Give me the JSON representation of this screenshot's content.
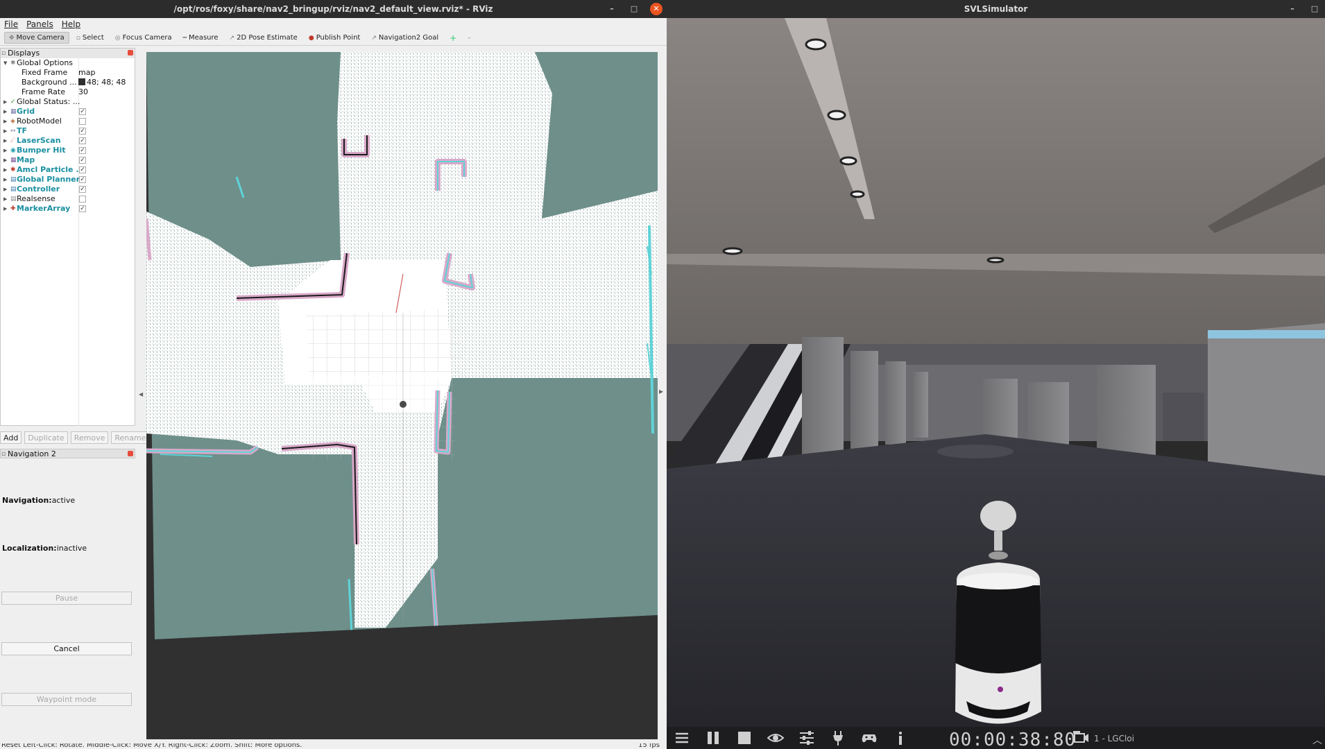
{
  "rviz": {
    "title": "/opt/ros/foxy/share/nav2_bringup/rviz/nav2_default_view.rviz* - RViz",
    "menu": [
      "File",
      "Panels",
      "Help"
    ],
    "tools": [
      {
        "label": "Move Camera",
        "icon": "move-camera-icon",
        "active": true
      },
      {
        "label": "Select",
        "icon": "select-icon"
      },
      {
        "label": "Focus Camera",
        "icon": "focus-camera-icon"
      },
      {
        "label": "Measure",
        "icon": "measure-icon"
      },
      {
        "label": "2D Pose Estimate",
        "icon": "pose-estimate-icon"
      },
      {
        "label": "Publish Point",
        "icon": "publish-point-icon"
      },
      {
        "label": "Navigation2 Goal",
        "icon": "nav-goal-icon"
      }
    ],
    "add_tool_glyph": "+",
    "more_tools_glyph": "–",
    "displays": {
      "header": "Displays",
      "global_options": "Global Options",
      "fixed_frame_label": "Fixed Frame",
      "fixed_frame_value": "map",
      "background_label": "Background ...",
      "background_value": "48; 48; 48",
      "frame_rate_label": "Frame Rate",
      "frame_rate_value": "30",
      "global_status": "Global Status: ...",
      "items": [
        {
          "label": "Grid",
          "checked": true
        },
        {
          "label": "RobotModel",
          "checked": false
        },
        {
          "label": "TF",
          "checked": true
        },
        {
          "label": "LaserScan",
          "checked": true
        },
        {
          "label": "Bumper Hit",
          "checked": true
        },
        {
          "label": "Map",
          "checked": true
        },
        {
          "label": "Amcl Particle ...",
          "checked": true
        },
        {
          "label": "Global Planner",
          "checked": true
        },
        {
          "label": "Controller",
          "checked": true
        },
        {
          "label": "Realsense",
          "checked": false
        },
        {
          "label": "MarkerArray",
          "checked": true
        }
      ]
    },
    "buttons": {
      "add": "Add",
      "duplicate": "Duplicate",
      "remove": "Remove",
      "rename": "Rename"
    },
    "nav2": {
      "header": "Navigation 2",
      "navigation_label": "Navigation:",
      "navigation_value": "active",
      "localization_label": "Localization:",
      "localization_value": "inactive",
      "pause": "Pause",
      "cancel": "Cancel",
      "waypoint": "Waypoint mode"
    },
    "status": {
      "hint": "Reset   Left-Click: Rotate.  Middle-Click: Move X/Y.  Right-Click: Zoom.  Shift: More options.",
      "fps": "15 fps"
    },
    "colors": {
      "background": "#303030",
      "map_free": "#ffffff",
      "map_unknown": "#6e8f8a",
      "inflation": "#d9a9c9",
      "scan": "#5fd3d8"
    }
  },
  "svl": {
    "title": "SVLSimulator",
    "timer": "00:00:38:80",
    "vehicle": "1 - LGCloi",
    "controls": [
      "menu-icon",
      "pause-icon",
      "stop-icon",
      "eye-icon",
      "sliders-icon",
      "plug-icon",
      "gamepad-icon",
      "info-icon"
    ],
    "camera_icon": "camera-icon"
  }
}
